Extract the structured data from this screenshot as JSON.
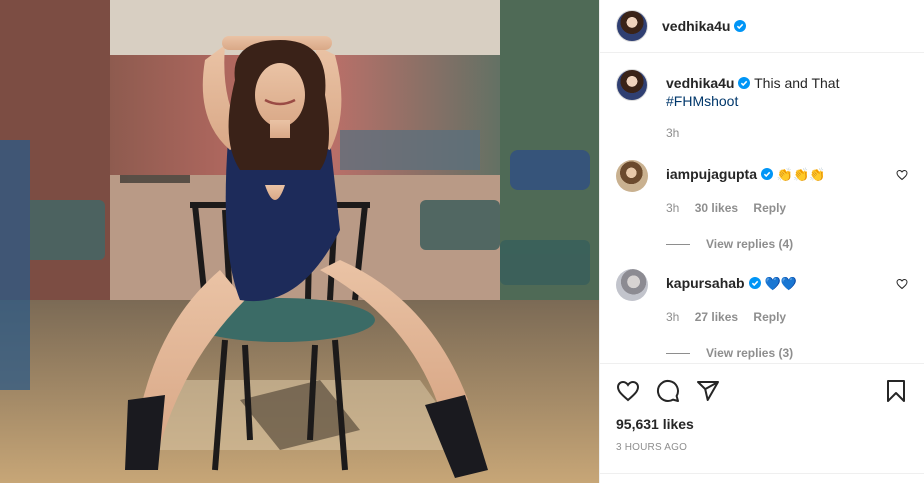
{
  "post": {
    "username": "vedhika4u",
    "verified": true,
    "caption": {
      "text": "This and That",
      "hashtag": "#FHMshoot",
      "time": "3h"
    },
    "comments": [
      {
        "username": "iampujagupta",
        "emoji": "👏👏👏",
        "time": "3h",
        "likes": "30 likes",
        "reply_label": "Reply",
        "view_replies": "View replies (4)"
      },
      {
        "username": "kapursahab",
        "emoji": "💙💙",
        "time": "3h",
        "likes": "27 likes",
        "reply_label": "Reply",
        "view_replies": "View replies (3)"
      }
    ],
    "likes": "95,631 likes",
    "timestamp": "3 HOURS AGO"
  },
  "icons": [
    "heart-icon",
    "comment-icon",
    "share-icon",
    "bookmark-icon",
    "verified-badge-icon"
  ],
  "colors": {
    "verified": "#0095f6",
    "hashtag": "#00376b",
    "muted": "#8e8e8e",
    "border": "#efefef"
  }
}
